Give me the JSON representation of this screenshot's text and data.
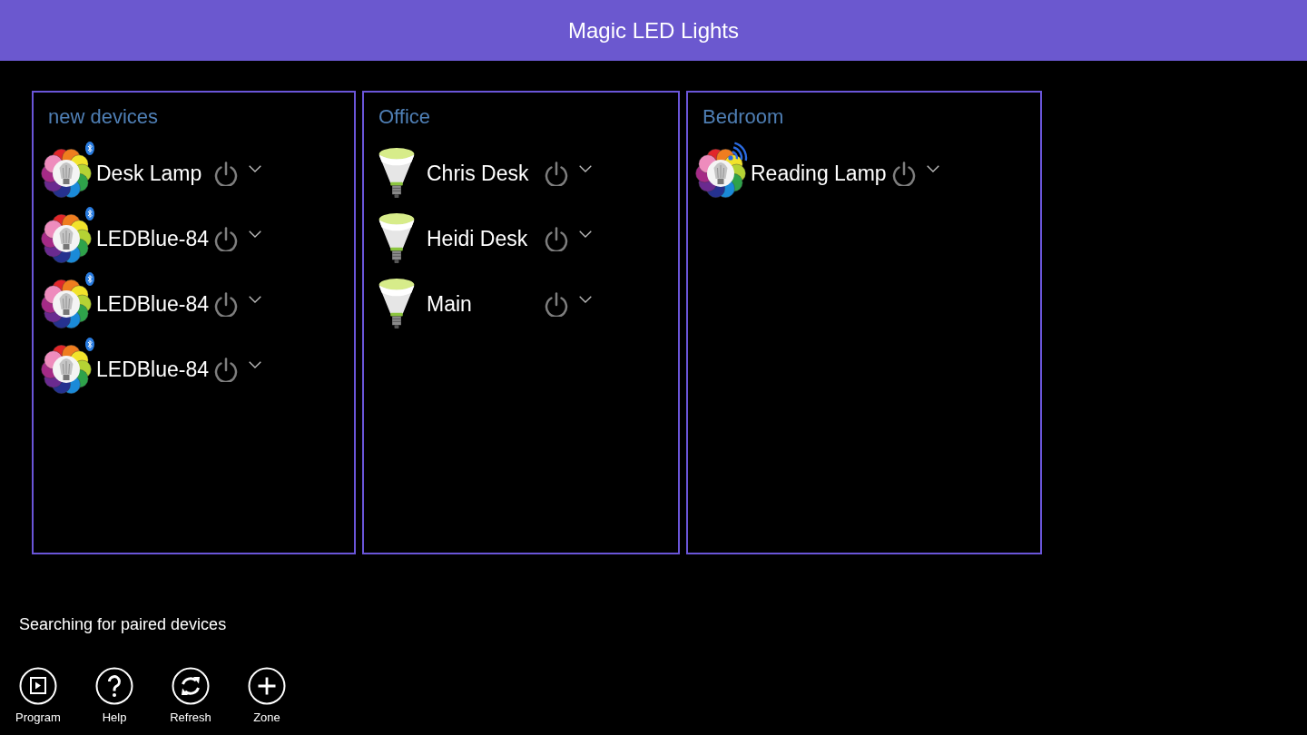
{
  "title_bar": {
    "title": "Magic LED Lights"
  },
  "zones": [
    {
      "name": "new devices",
      "devices": [
        {
          "name": "Desk Lamp",
          "kind": "color-bulb",
          "bluetooth": true,
          "wifi": false
        },
        {
          "name": "LEDBlue-84",
          "kind": "color-bulb",
          "bluetooth": true,
          "wifi": false
        },
        {
          "name": "LEDBlue-84",
          "kind": "color-bulb",
          "bluetooth": true,
          "wifi": false
        },
        {
          "name": "LEDBlue-84",
          "kind": "color-bulb",
          "bluetooth": true,
          "wifi": false
        }
      ]
    },
    {
      "name": "Office",
      "devices": [
        {
          "name": "Chris Desk",
          "kind": "flood-bulb",
          "bluetooth": false,
          "wifi": false
        },
        {
          "name": "Heidi Desk",
          "kind": "flood-bulb",
          "bluetooth": false,
          "wifi": false
        },
        {
          "name": "Main",
          "kind": "flood-bulb",
          "bluetooth": false,
          "wifi": false
        }
      ]
    },
    {
      "name": "Bedroom",
      "devices": [
        {
          "name": "Reading Lamp",
          "kind": "color-bulb",
          "bluetooth": false,
          "wifi": true
        }
      ]
    }
  ],
  "status_text": "Searching for paired devices",
  "app_bar": [
    {
      "label": "Program",
      "kind": "program"
    },
    {
      "label": "Help",
      "kind": "help"
    },
    {
      "label": "Refresh",
      "kind": "refresh"
    },
    {
      "label": "Zone",
      "kind": "add"
    }
  ]
}
